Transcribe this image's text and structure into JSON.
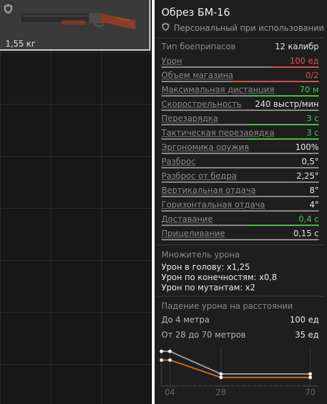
{
  "inventory": {
    "item_weight": "1,55 кг",
    "item_icon": "sawn-off-shotgun-icon"
  },
  "item": {
    "title": "Обрез БМ-16",
    "subtitle": "Персональный при использовании"
  },
  "stats": [
    {
      "label": "Тип боеприпасов",
      "value": "12 калибр",
      "color": "normal",
      "underline": false,
      "bar": null
    },
    {
      "label": "Урон",
      "value": "100 ед",
      "color": "red",
      "underline": true,
      "bar": {
        "fill": 0.3,
        "color": "#d9534f",
        "side": "right"
      }
    },
    {
      "label": "Объем магазина",
      "value": "0/2",
      "color": "red",
      "underline": true,
      "bar": {
        "fill": 0.55,
        "color": "#d9534f",
        "side": "right"
      }
    },
    {
      "label": "Максимальная дистанция",
      "value": "70 м",
      "color": "green",
      "underline": true,
      "bar": {
        "fill": 0.45,
        "color": "#49c14f",
        "side": "right"
      }
    },
    {
      "label": "Скорострельность",
      "value": "240 выстр/мин",
      "color": "normal",
      "underline": true,
      "bar": {
        "fill": 0,
        "color": "#8a8a8a",
        "side": "right"
      }
    },
    {
      "label": "Перезарядка",
      "value": "3 с",
      "color": "green",
      "underline": true,
      "bar": {
        "fill": 0.45,
        "color": "#49c14f",
        "side": "right"
      }
    },
    {
      "label": "Тактическая перезарядка",
      "value": "3 с",
      "color": "green",
      "underline": true,
      "bar": {
        "fill": 0.45,
        "color": "#49c14f",
        "side": "right"
      }
    },
    {
      "label": "Эргономика оружия",
      "value": "100%",
      "color": "normal",
      "underline": true,
      "bar": {
        "fill": 0,
        "color": "#8a8a8a",
        "side": "right"
      }
    },
    {
      "label": "Разброс",
      "value": "0,5°",
      "color": "normal",
      "underline": true,
      "bar": {
        "fill": 0,
        "color": "#8a8a8a",
        "side": "right"
      }
    },
    {
      "label": "Разброс от бедра",
      "value": "2,25°",
      "color": "normal",
      "underline": true,
      "bar": {
        "fill": 0,
        "color": "#8a8a8a",
        "side": "right"
      }
    },
    {
      "label": "Вертикальная отдача",
      "value": "8°",
      "color": "normal",
      "underline": true,
      "bar": {
        "fill": 0,
        "color": "#8a8a8a",
        "side": "right"
      }
    },
    {
      "label": "Горизонтальная отдача",
      "value": "4°",
      "color": "normal",
      "underline": true,
      "bar": {
        "fill": 0,
        "color": "#8a8a8a",
        "side": "right"
      }
    },
    {
      "label": "Доставание",
      "value": "0,4 с",
      "color": "green",
      "underline": true,
      "bar": {
        "fill": 0.45,
        "color": "#49c14f",
        "side": "right"
      }
    },
    {
      "label": "Прицеливание",
      "value": "0,15 с",
      "color": "normal",
      "underline": true,
      "bar": {
        "fill": 0,
        "color": "#8a8a8a",
        "side": "right"
      }
    }
  ],
  "damage_modifiers": {
    "title": "Множитель урона",
    "lines": [
      "Урон в голову: x1,25",
      "Урон по конечностям: x0,8",
      "Урон по мутантам: x2"
    ]
  },
  "damage_falloff": {
    "title": "Падение урона на расстоянии",
    "rows": [
      {
        "label": "До 4 метра",
        "value": "100 ед"
      },
      {
        "label": "От 28 до 70 метров",
        "value": "35 ед"
      }
    ]
  },
  "chart_data": {
    "type": "line",
    "x_ticks": [
      "04",
      "28",
      "70"
    ],
    "series": [
      {
        "color": "#9e9e9e",
        "points": [
          [
            0,
            100
          ],
          [
            4,
            100
          ],
          [
            28,
            35
          ],
          [
            70,
            35
          ]
        ]
      },
      {
        "color": "#c8701e",
        "points": [
          [
            0,
            75
          ],
          [
            4,
            75
          ],
          [
            28,
            25
          ],
          [
            70,
            25
          ]
        ]
      }
    ],
    "xlim": [
      0,
      74
    ],
    "ylim": [
      0,
      110
    ]
  },
  "colors": {
    "red": "#d9534f",
    "green": "#49c14f",
    "orange": "#c8701e"
  }
}
